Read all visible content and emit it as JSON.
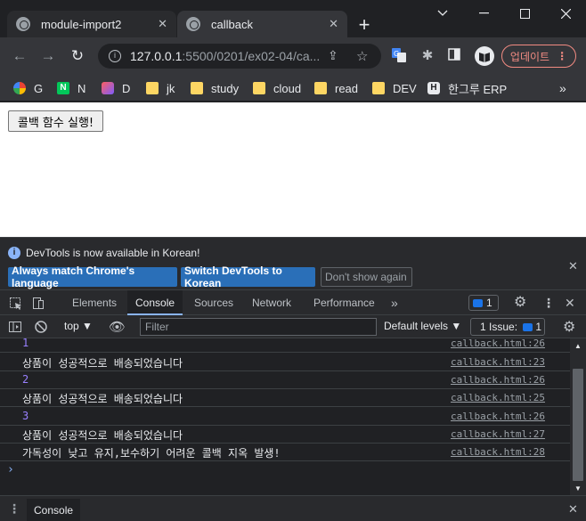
{
  "browser": {
    "tabs": [
      {
        "title": "module-import2",
        "active": false
      },
      {
        "title": "callback",
        "active": true
      }
    ],
    "url": {
      "host": "127.0.0.1",
      "path": ":5500/0201/ex02-04/ca..."
    },
    "update_label": "업데이트",
    "bookmarks": [
      {
        "label": "G",
        "icon": "google-icon"
      },
      {
        "label": "N",
        "icon": "naver-icon"
      },
      {
        "label": "D",
        "icon": "d-icon"
      },
      {
        "label": "jk",
        "icon": "folder-icon"
      },
      {
        "label": "study",
        "icon": "folder-icon"
      },
      {
        "label": "cloud",
        "icon": "folder-icon"
      },
      {
        "label": "read",
        "icon": "folder-icon"
      },
      {
        "label": "DEV",
        "icon": "folder-icon"
      },
      {
        "label": "한그루 ERP",
        "icon": "h-icon"
      }
    ],
    "more_bookmarks": "»"
  },
  "page": {
    "button_label": "콜백 함수 실행!"
  },
  "devtools": {
    "infobar": {
      "text": "DevTools is now available in Korean!",
      "match_label": "Always match Chrome's language",
      "switch_label": "Switch DevTools to Korean",
      "dont_show_label": "Don't show again"
    },
    "tabs": [
      "Elements",
      "Console",
      "Sources",
      "Network",
      "Performance"
    ],
    "more_tabs": "»",
    "issues_badge": "1",
    "console_toolbar": {
      "context": "top",
      "filter_placeholder": "Filter",
      "levels": "Default levels",
      "issues": "1 Issue:",
      "issues_count": "1"
    },
    "messages": [
      {
        "text": "1",
        "source": "callback.html:26",
        "type": "number"
      },
      {
        "text": "상품이 성공적으로 배송되었습니다",
        "source": "callback.html:23",
        "type": "string"
      },
      {
        "text": "2",
        "source": "callback.html:26",
        "type": "number"
      },
      {
        "text": "상품이 성공적으로 배송되었습니다",
        "source": "callback.html:25",
        "type": "string"
      },
      {
        "text": "3",
        "source": "callback.html:26",
        "type": "number"
      },
      {
        "text": "상품이 성공적으로 배송되었습니다",
        "source": "callback.html:27",
        "type": "string"
      },
      {
        "text": "가독성이 낮고 유지,보수하기 어려운 콜백 지옥 발생!",
        "source": "callback.html:28",
        "type": "string"
      }
    ],
    "prompt": "›",
    "drawer_tab": "Console"
  }
}
